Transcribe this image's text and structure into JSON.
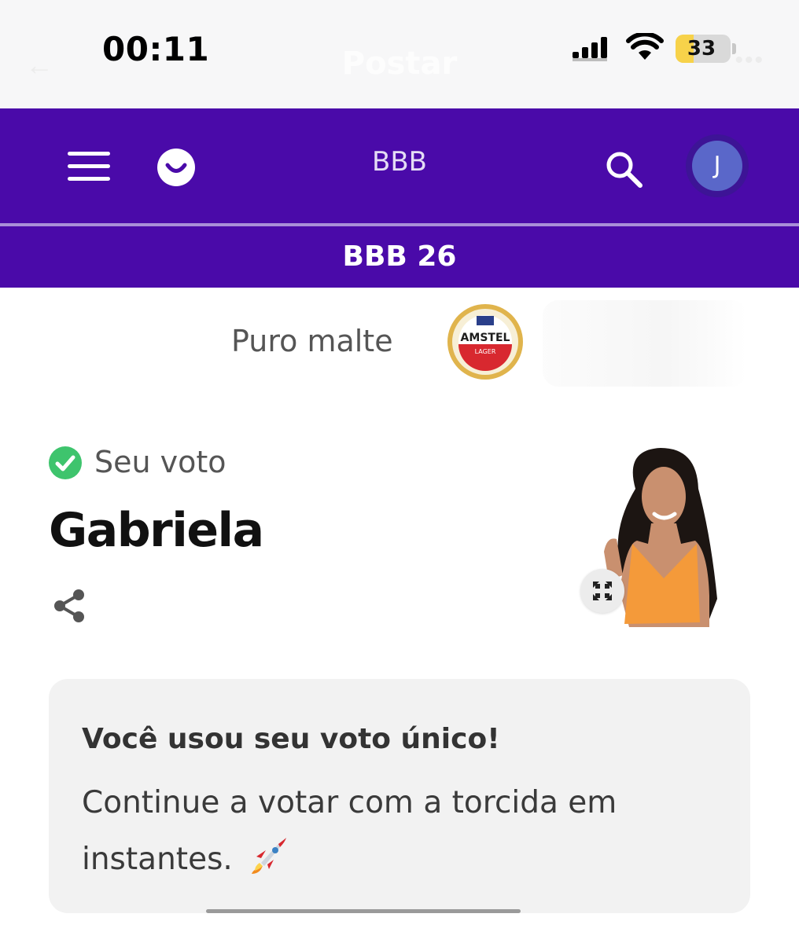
{
  "status_bar": {
    "time": "00:11",
    "battery_level": "33",
    "battery_fraction": 0.33,
    "ghost_title": "Postar",
    "icons": [
      "signal-icon",
      "wifi-icon",
      "battery-icon"
    ]
  },
  "header": {
    "title": "BBB",
    "avatar_initial": "J",
    "icons": [
      "menu-icon",
      "smile-logo-icon",
      "search-icon"
    ],
    "colors": {
      "primary": "#4a0aa9",
      "divider": "#a98fd9",
      "avatar": "#5a67c9"
    }
  },
  "section": {
    "title": "BBB 26"
  },
  "sponsor": {
    "text": "Puro malte",
    "logo_word": "AMSTEL",
    "logo_subword": "LAGER"
  },
  "vote": {
    "label": "Seu voto",
    "candidate": "Gabriela",
    "icons": [
      "check-circle-icon",
      "share-icon",
      "expand-icon"
    ],
    "colors": {
      "check": "#3ec46d"
    }
  },
  "info": {
    "title": "Você usou seu voto único!",
    "body": "Continue a votar com a torcida em instantes.",
    "emoji": "rocket-icon"
  }
}
